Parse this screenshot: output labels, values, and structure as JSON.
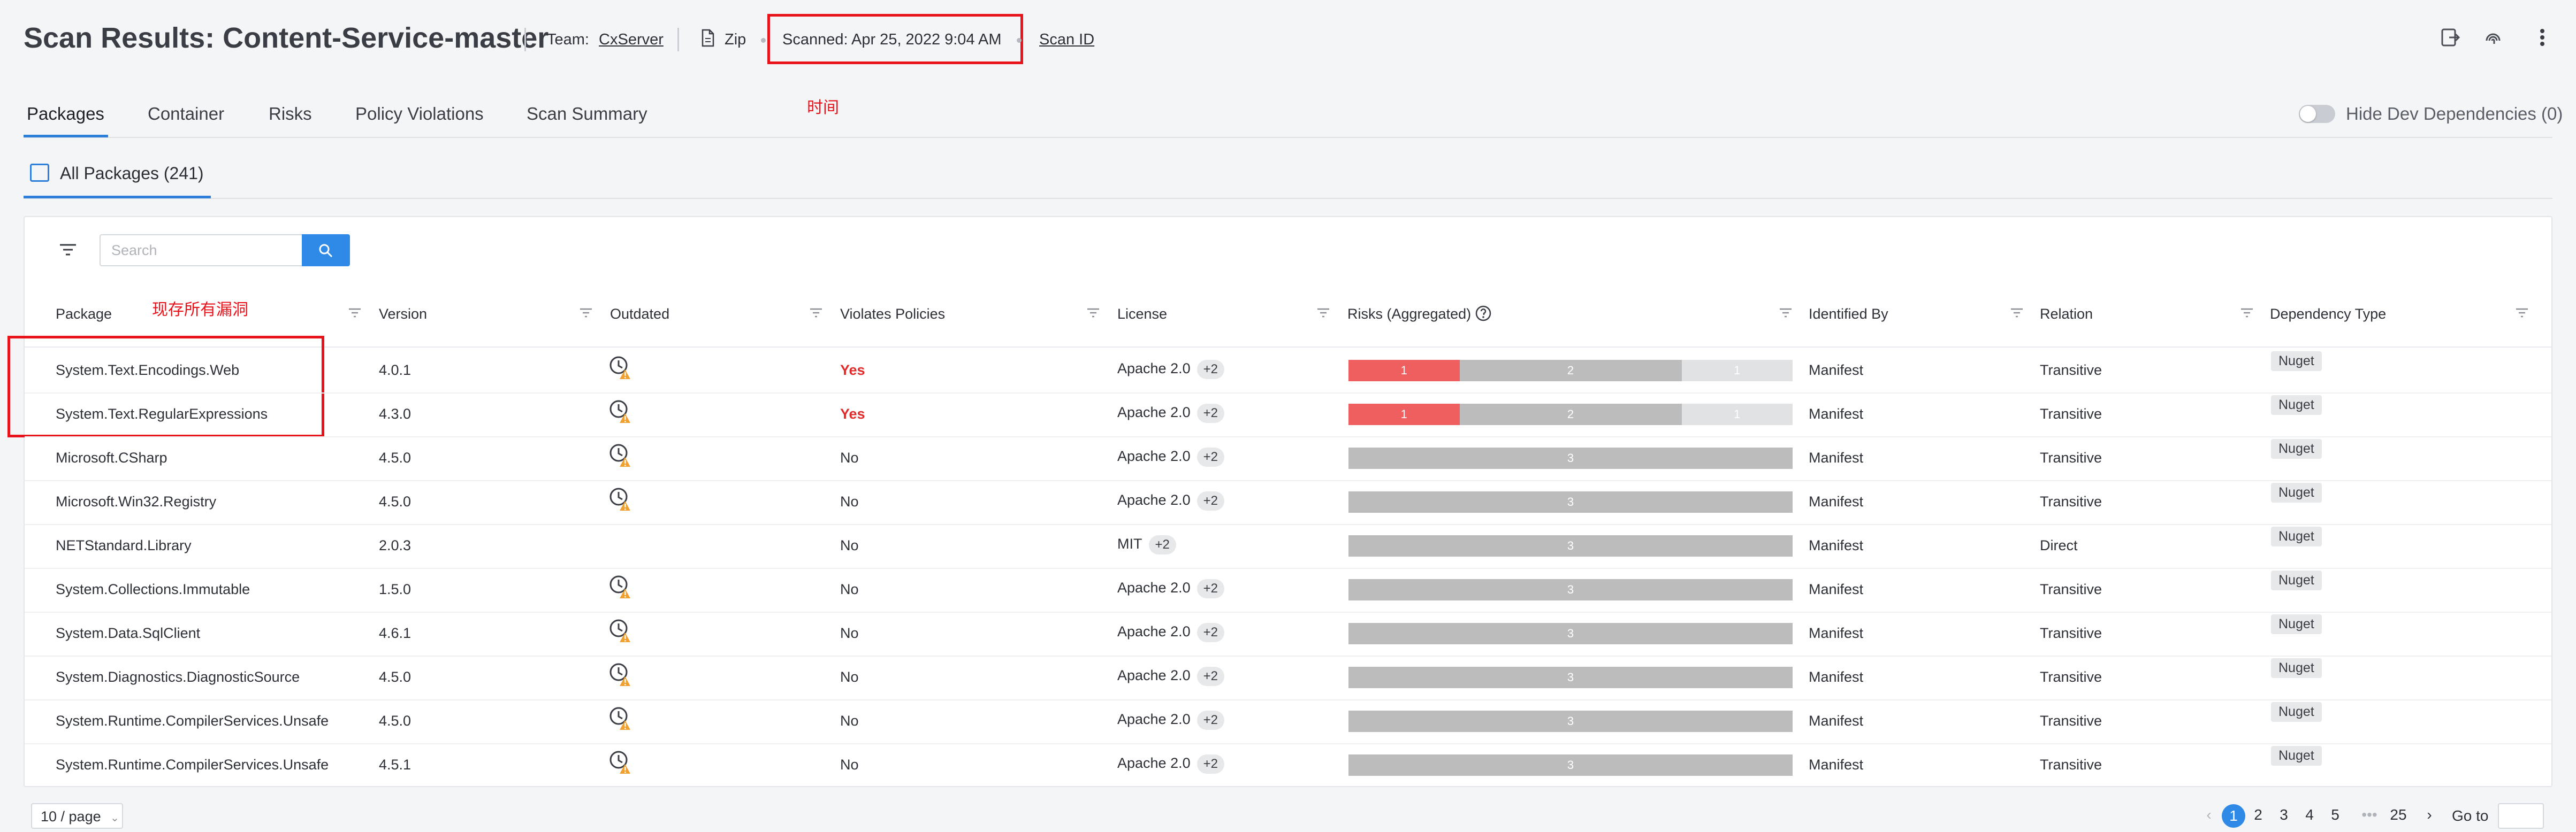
{
  "header": {
    "title": "Scan Results: Content-Service-master",
    "team_label": "Team:",
    "team_value": "CxServer",
    "source": "Zip",
    "scanned": "Scanned:  Apr 25, 2022 9:04 AM",
    "scan_id": "Scan ID"
  },
  "annotations": {
    "time": "时间",
    "vulns": "现存所有漏洞"
  },
  "tabs": [
    "Packages",
    "Container",
    "Risks",
    "Policy Violations",
    "Scan Summary"
  ],
  "toggle": {
    "label": "Hide Dev Dependencies (0)",
    "on": false
  },
  "subtab": {
    "label": "All Packages (241)"
  },
  "search": {
    "placeholder": "Search",
    "value": ""
  },
  "columns": [
    "Package",
    "Version",
    "Outdated",
    "Violates Policies",
    "License",
    "Risks (Aggregated)",
    "Identified By",
    "Relation",
    "Dependency Type"
  ],
  "rows": [
    {
      "package": "System.Text.Encodings.Web",
      "version": "4.0.1",
      "outdated": true,
      "violates": "Yes",
      "license": "Apache 2.0",
      "license_more": "+2",
      "risks": [
        1,
        2,
        1
      ],
      "identified": "Manifest",
      "relation": "Transitive",
      "dep": "Nuget"
    },
    {
      "package": "System.Text.RegularExpressions",
      "version": "4.3.0",
      "outdated": true,
      "violates": "Yes",
      "license": "Apache 2.0",
      "license_more": "+2",
      "risks": [
        1,
        2,
        1
      ],
      "identified": "Manifest",
      "relation": "Transitive",
      "dep": "Nuget"
    },
    {
      "package": "Microsoft.CSharp",
      "version": "4.5.0",
      "outdated": true,
      "violates": "No",
      "license": "Apache 2.0",
      "license_more": "+2",
      "risks": [
        0,
        3,
        0
      ],
      "identified": "Manifest",
      "relation": "Transitive",
      "dep": "Nuget"
    },
    {
      "package": "Microsoft.Win32.Registry",
      "version": "4.5.0",
      "outdated": true,
      "violates": "No",
      "license": "Apache 2.0",
      "license_more": "+2",
      "risks": [
        0,
        3,
        0
      ],
      "identified": "Manifest",
      "relation": "Transitive",
      "dep": "Nuget"
    },
    {
      "package": "NETStandard.Library",
      "version": "2.0.3",
      "outdated": false,
      "violates": "No",
      "license": "MIT",
      "license_more": "+2",
      "risks": [
        0,
        3,
        0
      ],
      "identified": "Manifest",
      "relation": "Direct",
      "dep": "Nuget"
    },
    {
      "package": "System.Collections.Immutable",
      "version": "1.5.0",
      "outdated": true,
      "violates": "No",
      "license": "Apache 2.0",
      "license_more": "+2",
      "risks": [
        0,
        3,
        0
      ],
      "identified": "Manifest",
      "relation": "Transitive",
      "dep": "Nuget"
    },
    {
      "package": "System.Data.SqlClient",
      "version": "4.6.1",
      "outdated": true,
      "violates": "No",
      "license": "Apache 2.0",
      "license_more": "+2",
      "risks": [
        0,
        3,
        0
      ],
      "identified": "Manifest",
      "relation": "Transitive",
      "dep": "Nuget"
    },
    {
      "package": "System.Diagnostics.DiagnosticSource",
      "version": "4.5.0",
      "outdated": true,
      "violates": "No",
      "license": "Apache 2.0",
      "license_more": "+2",
      "risks": [
        0,
        3,
        0
      ],
      "identified": "Manifest",
      "relation": "Transitive",
      "dep": "Nuget"
    },
    {
      "package": "System.Runtime.CompilerServices.Unsafe",
      "version": "4.5.0",
      "outdated": true,
      "violates": "No",
      "license": "Apache 2.0",
      "license_more": "+2",
      "risks": [
        0,
        3,
        0
      ],
      "identified": "Manifest",
      "relation": "Transitive",
      "dep": "Nuget"
    },
    {
      "package": "System.Runtime.CompilerServices.Unsafe",
      "version": "4.5.1",
      "outdated": true,
      "violates": "No",
      "license": "Apache 2.0",
      "license_more": "+2",
      "risks": [
        0,
        3,
        0
      ],
      "identified": "Manifest",
      "relation": "Transitive",
      "dep": "Nuget"
    }
  ],
  "pagination": {
    "page_size": "10 / page",
    "pages": [
      "1",
      "2",
      "3",
      "4",
      "5",
      "•••",
      "25"
    ],
    "current": "1",
    "goto_label": "Go to"
  },
  "colors": {
    "accent": "#2e8ae6",
    "risk_high": "#ef5f5f",
    "risk_medium": "#bcbcbc",
    "risk_low": "#e1e2e4",
    "annotation": "#e8121b"
  }
}
